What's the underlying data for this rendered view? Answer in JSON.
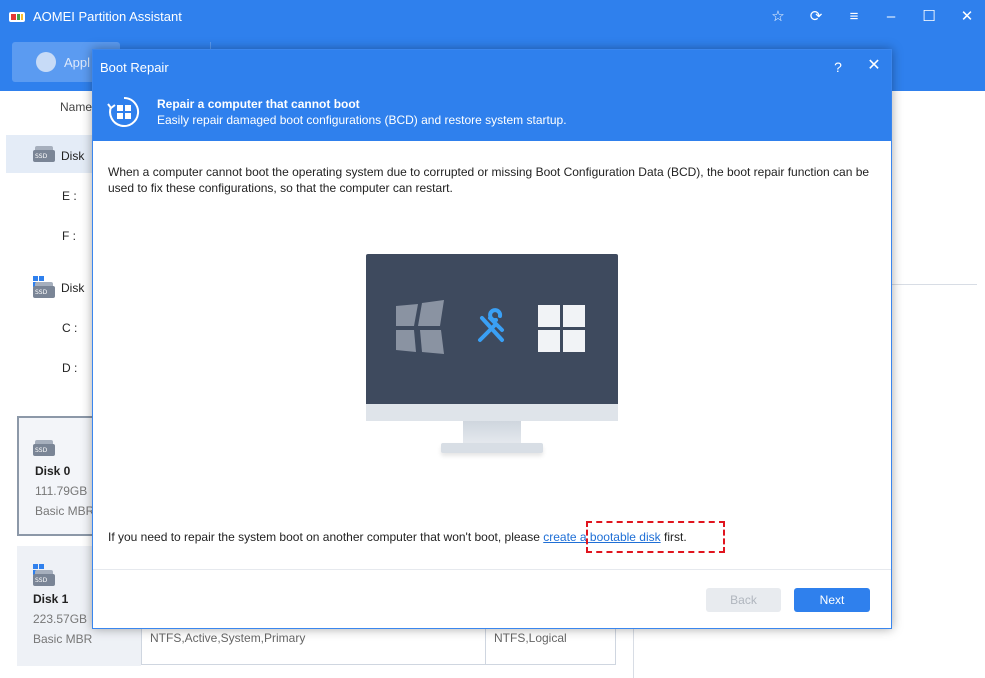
{
  "app": {
    "title": "AOMEI Partition Assistant",
    "apply_label": "Appl",
    "name_column": "Name"
  },
  "left_list": {
    "disk_label_a": "Disk",
    "part_e": "E :",
    "part_f": "F :",
    "disk_label_b": "Disk",
    "part_c": "C :",
    "part_d": "D :"
  },
  "cards": [
    {
      "title": "Disk 0",
      "size": "111.79GB",
      "type": "Basic MBR"
    },
    {
      "title": "Disk 1",
      "size": "223.57GB",
      "type": "Basic MBR"
    }
  ],
  "partitions": {
    "p1": "NTFS,Active,System,Primary",
    "p2": "NTFS,Logical"
  },
  "dialog": {
    "title": "Boot Repair",
    "help": "?",
    "close": "✕",
    "header_title": "Repair a computer that cannot boot",
    "header_sub": "Easily repair damaged boot configurations (BCD) and restore system startup.",
    "body": "When a computer cannot boot the operating system due to corrupted or missing Boot Configuration Data (BCD), the boot repair function can be used to fix these configurations, so that the computer can restart.",
    "bottom_prefix": "If you need to repair the system boot on another computer that won't boot, please ",
    "bottom_link": "create a bootable disk",
    "bottom_suffix": " first.",
    "back_label": "Back",
    "next_label": "Next"
  },
  "colors": {
    "accent": "#2f80ed",
    "highlight": "#e0141e"
  },
  "icons": [
    "app-logo-icon",
    "star-icon",
    "refresh-icon",
    "menu-icon",
    "maximize-icon",
    "close-icon",
    "ssd-icon",
    "windows-icon",
    "boot-repair-icon",
    "broken-windows-icon",
    "tools-icon"
  ]
}
